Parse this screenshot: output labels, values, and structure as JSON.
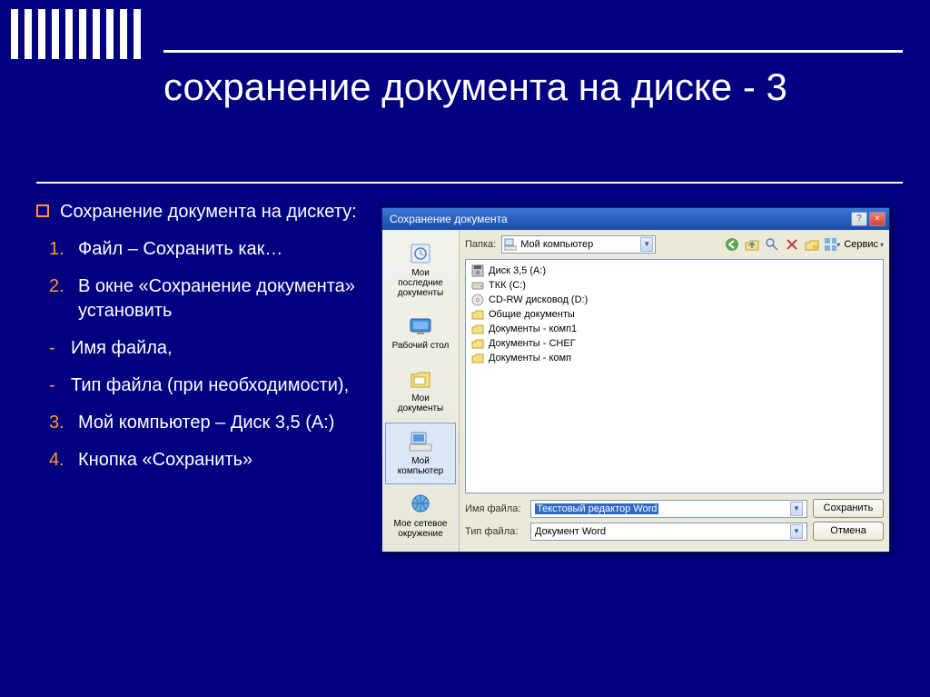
{
  "slide": {
    "title": "сохранение документа на диске - 3",
    "bullet_intro": "Сохранение документа на дискету:",
    "steps": [
      {
        "n": "1.",
        "text": "Файл – Сохранить как…"
      },
      {
        "n": "2.",
        "text": "В окне «Сохранение документа» установить"
      }
    ],
    "dashes": [
      "Имя файла,",
      "Тип файла (при необходимости),"
    ],
    "steps2": [
      {
        "n": "3.",
        "text": "Мой компьютер – Диск 3,5 (А:)"
      },
      {
        "n": "4.",
        "text": "Кнопка «Сохранить»"
      }
    ]
  },
  "dialog": {
    "title": "Сохранение документа",
    "folder_label": "Папка:",
    "folder_value": "Мой компьютер",
    "service_label": "Сервис",
    "places": [
      "Мои последние документы",
      "Рабочий стол",
      "Мои документы",
      "Мой компьютер",
      "Мое сетевое окружение"
    ],
    "items": [
      {
        "icon": "floppy",
        "name": "Диск 3,5 (A:)"
      },
      {
        "icon": "hdd",
        "name": "ТКК (C:)"
      },
      {
        "icon": "cd",
        "name": "CD-RW дисковод (D:)"
      },
      {
        "icon": "folder",
        "name": "Общие документы"
      },
      {
        "icon": "folder",
        "name": "Документы - комп1"
      },
      {
        "icon": "folder",
        "name": "Документы - СНЕГ"
      },
      {
        "icon": "folder",
        "name": "Документы - комп"
      }
    ],
    "filename_label": "Имя файла:",
    "filename_value": "Текстовый редактор Word",
    "filetype_label": "Тип файла:",
    "filetype_value": "Документ Word",
    "save_btn": "Сохранить",
    "cancel_btn": "Отмена"
  }
}
